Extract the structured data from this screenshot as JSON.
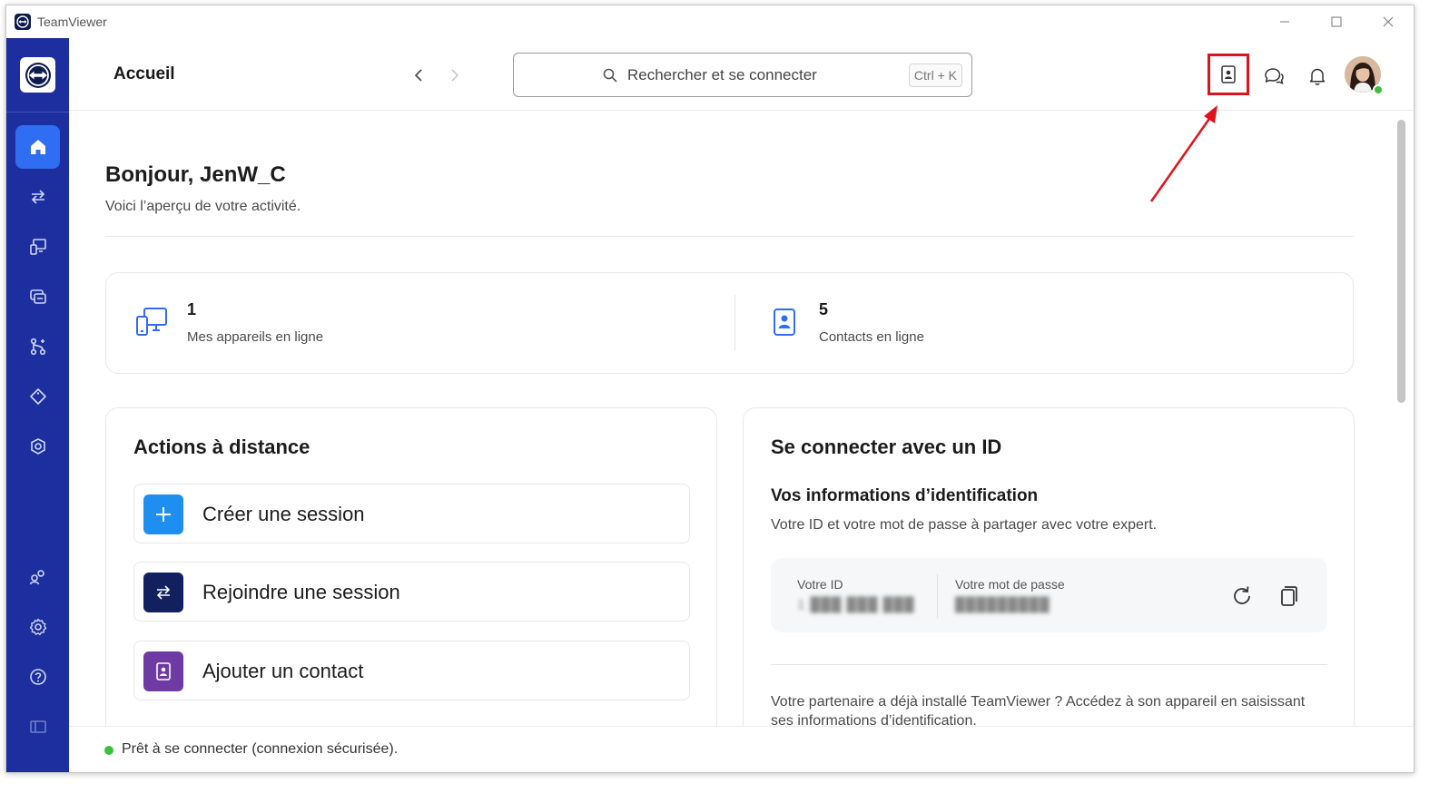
{
  "window": {
    "title": "TeamViewer",
    "controls": {
      "minimize": "—",
      "maximize": "☐",
      "close": "✕"
    }
  },
  "sidebar": {
    "items": [
      {
        "name": "home",
        "icon": "home-icon",
        "active": true
      },
      {
        "name": "remote-connections",
        "icon": "swap-arrows-icon"
      },
      {
        "name": "devices",
        "icon": "devices-icon"
      },
      {
        "name": "sessions",
        "icon": "sessions-icon"
      },
      {
        "name": "integrations",
        "icon": "flow-icon"
      },
      {
        "name": "tags",
        "icon": "tag-icon"
      },
      {
        "name": "security",
        "icon": "shield-icon"
      },
      {
        "name": "community",
        "icon": "people-icon"
      },
      {
        "name": "settings",
        "icon": "gear-icon"
      },
      {
        "name": "help",
        "icon": "help-icon"
      },
      {
        "name": "collapse",
        "icon": "collapse-sidebar-icon"
      }
    ],
    "colors": {
      "background": "#1d2f9e",
      "active": "#2f6df2"
    }
  },
  "header": {
    "title": "Accueil",
    "search": {
      "placeholder": "Rechercher et se connecter",
      "shortcut": "Ctrl + K"
    },
    "icons": [
      "contacts-icon",
      "chat-icon",
      "bell-icon",
      "avatar"
    ]
  },
  "home": {
    "greeting": "Bonjour, JenW_C",
    "subtitle": "Voici l’aperçu de votre activité.",
    "stats": [
      {
        "value": "1",
        "label": "Mes appareils en ligne",
        "icon": "devices-icon"
      },
      {
        "value": "5",
        "label": "Contacts en ligne",
        "icon": "contacts-icon"
      }
    ],
    "remote_actions": {
      "title": "Actions à distance",
      "items": [
        {
          "label": "Créer une session",
          "icon": "plus-icon",
          "color": "#1e8ff0"
        },
        {
          "label": "Rejoindre une session",
          "icon": "swap-arrows-icon",
          "color": "#13205f"
        },
        {
          "label": "Ajouter un contact",
          "icon": "contacts-icon",
          "color": "#6e3aa3"
        }
      ]
    },
    "connect_id": {
      "title": "Se connecter avec un ID",
      "cred_heading": "Vos informations d’identification",
      "cred_desc": "Votre ID et votre mot de passe à partager avec votre expert.",
      "id_label": "Votre ID",
      "id_value": "1 ███ ███ ███",
      "password_label": "Votre mot de passe",
      "password_value": "█████████",
      "partner_text": "Votre partenaire a déjà installé TeamViewer ? Accédez à son appareil en saisissant ses informations d’identification."
    }
  },
  "status": {
    "text": "Prêt à se connecter (connexion sécurisée).",
    "color": "#3cc13b"
  }
}
